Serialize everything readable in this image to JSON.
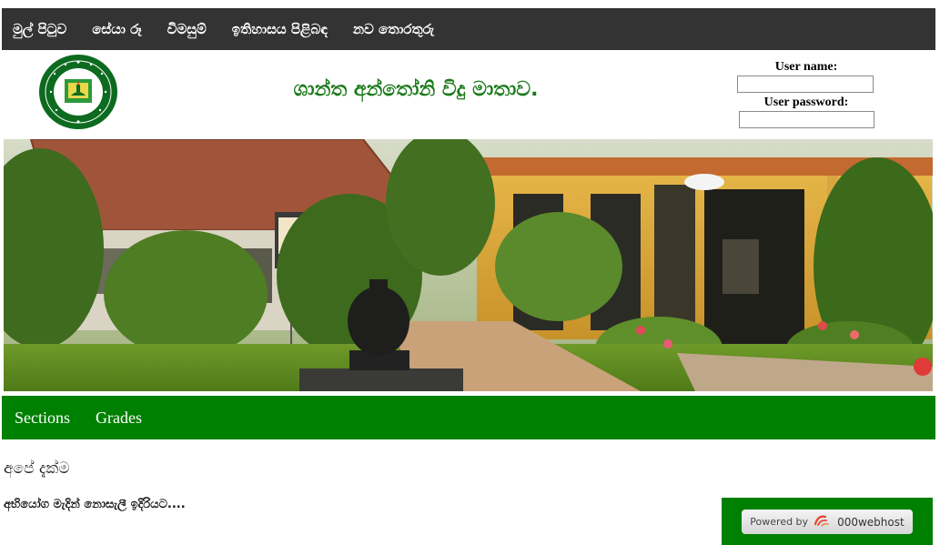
{
  "top_nav": {
    "items": [
      {
        "label": "මුල් පිටුව"
      },
      {
        "label": "සේයා රූ"
      },
      {
        "label": "විමසුම්"
      },
      {
        "label": "ඉතිහාසය පිළිබඳ"
      },
      {
        "label": "නව තොරතුරු"
      }
    ]
  },
  "header": {
    "title": "ශාන්ත අන්තෝනි විදු මාතාව.",
    "logo_icon": "school-crest-icon"
  },
  "login": {
    "username_label": "User name:",
    "username_value": "",
    "password_label": "User password:",
    "password_value": ""
  },
  "banner": {
    "image": "school-campus-photo"
  },
  "section_nav": {
    "items": [
      {
        "label": "Sections"
      },
      {
        "label": "Grades"
      }
    ]
  },
  "content": {
    "heading": "අපේ දැක්ම",
    "text": "අභියෝග මැදින් නොසැලී ඉදිරියට...."
  },
  "footer_badge": {
    "prefix": "Powered by",
    "brand": "000webhost",
    "icon": "webhost-swirl-icon"
  },
  "colors": {
    "top_nav_bg": "#333333",
    "accent_green": "#008000",
    "title_green": "#1a7a1a"
  }
}
